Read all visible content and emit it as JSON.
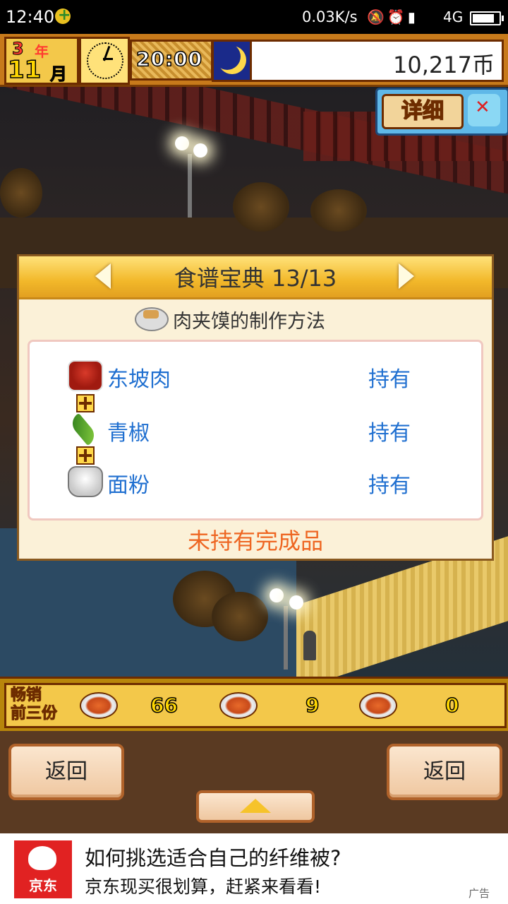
{
  "status_bar": {
    "time": "12:40",
    "network_speed": "0.03K/s",
    "network_type": "4G"
  },
  "hud": {
    "year_num": "3",
    "year_unit": "年",
    "month_num": "11",
    "month_unit": "月",
    "time": "20:00",
    "money": "10,217币"
  },
  "detail_button": {
    "label": "详细"
  },
  "recipe_dialog": {
    "title": "食谱宝典 13/13",
    "subtitle": "肉夹馍的制作方法",
    "ingredients": [
      {
        "name": "东坡肉",
        "status": "持有",
        "icon": "braised-pork-icon"
      },
      {
        "name": "青椒",
        "status": "持有",
        "icon": "green-pepper-icon"
      },
      {
        "name": "面粉",
        "status": "持有",
        "icon": "flour-sack-icon"
      }
    ],
    "result_status": "未持有完成品"
  },
  "bestsellers": {
    "label_line1": "畅销",
    "label_line2": "前三份",
    "items": [
      {
        "icon": "roast-fish-dish-icon",
        "count": "66"
      },
      {
        "icon": "stir-fry-dish-icon",
        "count": "9"
      },
      {
        "icon": "dessert-dish-icon",
        "count": "0"
      }
    ]
  },
  "nav": {
    "back_left": "返回",
    "back_right": "返回"
  },
  "ad": {
    "brand": "京东",
    "headline": "如何挑选适合自己的纤维被?",
    "subline": "京东现买很划算，赶紧来看看!",
    "tag": "广告"
  },
  "colors": {
    "accent_link": "#1f6fd0",
    "result_orange": "#ee6622",
    "hud_brown": "#c77a1b",
    "ad_red": "#e12222"
  }
}
